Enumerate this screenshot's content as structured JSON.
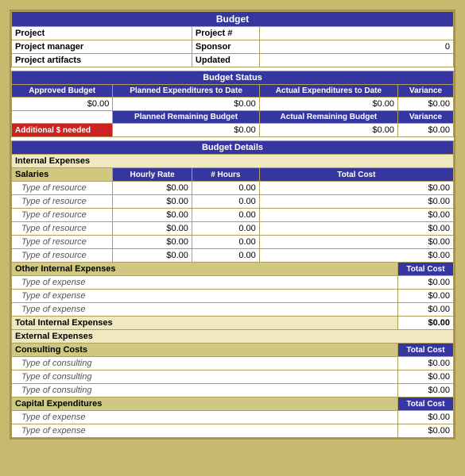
{
  "title": "Budget",
  "header": {
    "project_label": "Project",
    "project_number_label": "Project #",
    "project_number_value": "",
    "project_manager_label": "Project manager",
    "sponsor_label": "Sponsor",
    "sponsor_value": "0",
    "project_artifacts_label": "Project artifacts",
    "updated_label": "Updated",
    "updated_value": ""
  },
  "budget_status": {
    "title": "Budget Status",
    "approved_budget_label": "Approved Budget",
    "planned_expenditures_label": "Planned Expenditures to Date",
    "actual_expenditures_label": "Actual Expenditures to Date",
    "variance_label": "Variance",
    "approved_value": "$0.00",
    "planned_value": "$0.00",
    "actual_value": "$0.00",
    "variance_value": "$0.00",
    "planned_remaining_label": "Planned Remaining Budget",
    "actual_remaining_label": "Actual Remaining Budget",
    "variance2_label": "Variance",
    "planned_remaining_value": "$0.00",
    "actual_remaining_value": "$0.00",
    "variance2_value": "$0.00",
    "additional_needed_label": "Additional $ needed"
  },
  "budget_details": {
    "title": "Budget Details",
    "internal_expenses_label": "Internal Expenses",
    "salaries_label": "Salaries",
    "hourly_rate_label": "Hourly Rate",
    "hours_label": "# Hours",
    "total_cost_label": "Total Cost",
    "resources": [
      {
        "name": "Type of resource",
        "rate": "$0.00",
        "hours": "0.00",
        "cost": "$0.00"
      },
      {
        "name": "Type of resource",
        "rate": "$0.00",
        "hours": "0.00",
        "cost": "$0.00"
      },
      {
        "name": "Type of resource",
        "rate": "$0.00",
        "hours": "0.00",
        "cost": "$0.00"
      },
      {
        "name": "Type of resource",
        "rate": "$0.00",
        "hours": "0.00",
        "cost": "$0.00"
      },
      {
        "name": "Type of resource",
        "rate": "$0.00",
        "hours": "0.00",
        "cost": "$0.00"
      },
      {
        "name": "Type of resource",
        "rate": "$0.00",
        "hours": "0.00",
        "cost": "$0.00"
      }
    ],
    "other_internal_label": "Other Internal Expenses",
    "total_cost_label2": "Total Cost",
    "other_expenses": [
      {
        "name": "Type of expense",
        "cost": "$0.00"
      },
      {
        "name": "Type of expense",
        "cost": "$0.00"
      },
      {
        "name": "Type of expense",
        "cost": "$0.00"
      }
    ],
    "total_internal_label": "Total Internal Expenses",
    "total_internal_value": "$0.00",
    "external_expenses_label": "External Expenses",
    "consulting_costs_label": "Consulting Costs",
    "consulting_total_cost_label": "Total Cost",
    "consulting_items": [
      {
        "name": "Type of consulting",
        "cost": "$0.00"
      },
      {
        "name": "Type of consulting",
        "cost": "$0.00"
      },
      {
        "name": "Type of consulting",
        "cost": "$0.00"
      }
    ],
    "capital_expenditures_label": "Capital Expenditures",
    "capital_total_cost_label": "Total Cost",
    "capital_items": [
      {
        "name": "Type of expense",
        "cost": "$0.00"
      },
      {
        "name": "Type of expense",
        "cost": "$0.00"
      }
    ]
  }
}
